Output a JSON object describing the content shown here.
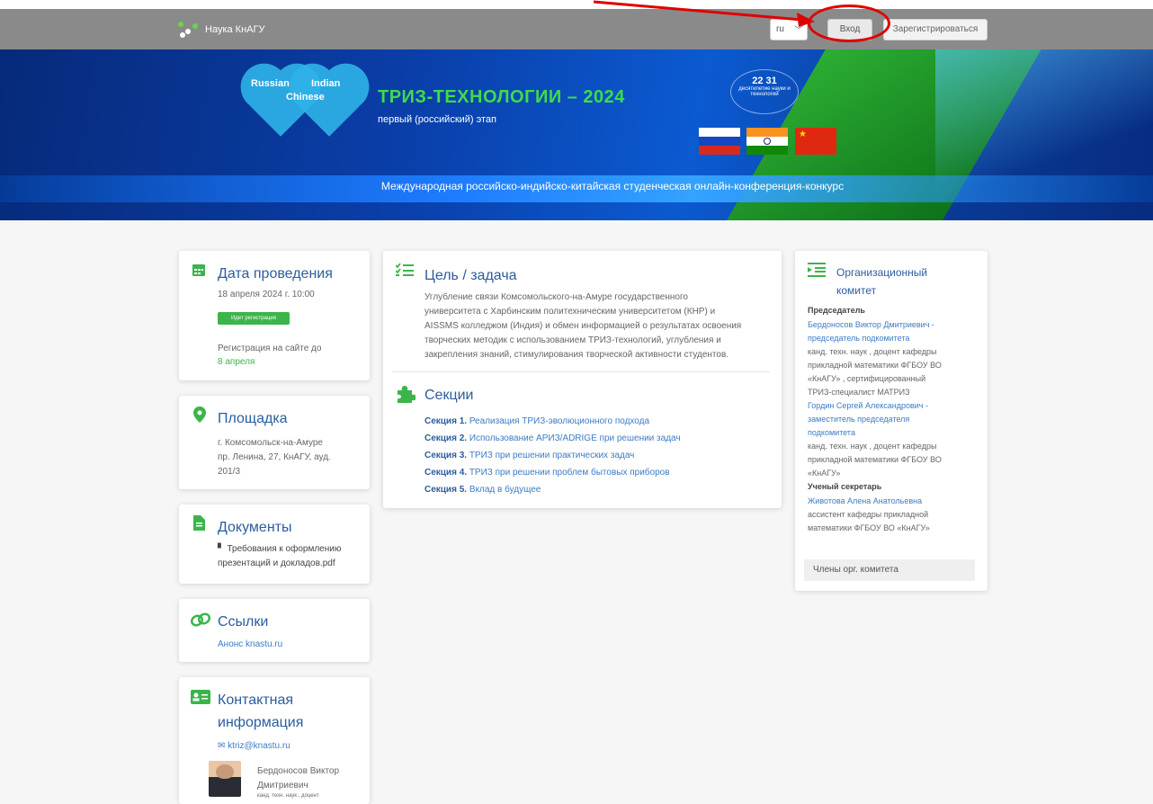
{
  "navbar": {
    "brand": "Наука КнАГУ",
    "lang": "ru",
    "login_label": "Вход",
    "register_label": "Зарегистрироваться"
  },
  "banner": {
    "heart_left": "Russian",
    "heart_right": "Indian",
    "heart_center": "Chinese",
    "title": "ТРИЗ-ТЕХНОЛОГИИ – 2024",
    "subtitle": "первый (российский) этап",
    "emblem_number": "22",
    "emblem_number2": "31",
    "emblem_text": "десятилетие науки и технологий",
    "bottom_text": "Международная российско-индийско-китайская студенческая онлайн-конференция-конкурс"
  },
  "date_card": {
    "title": "Дата проведения",
    "date": "18 апреля 2024 г. 10:00",
    "badge": "Идет регистрация",
    "reg_label": "Регистрация на сайте до",
    "reg_date": "8 апреля"
  },
  "venue_card": {
    "title": "Площадка",
    "line1": "г. Комсомольск-на-Амуре",
    "line2": "пр. Ленина, 27, КнАГУ, ауд.",
    "line3": "201/3"
  },
  "docs_card": {
    "title": "Документы",
    "doc1": "Требования к оформлению",
    "doc2": "презентаций и докладов.pdf"
  },
  "links_card": {
    "title": "Ссылки",
    "link1": "Анонс knastu.ru"
  },
  "contact_card": {
    "title1": "Контактная",
    "title2": "информация",
    "email": "ktriz@knastu.ru",
    "person1": "Бердоносов Виктор",
    "person2": "Дмитриевич",
    "person3": "канд. техн. наук , доцент"
  },
  "goal_card": {
    "title": "Цель / задача",
    "lines": [
      "Углубление связи Комсомольского-на-Амуре государственного",
      "университета с Харбинским политехническим университетом (КНР) и",
      "AISSMS колледжом (Индия) и обмен информацией о результатах освоения",
      "творческих методик с использованием ТРИЗ-технологий, углубления и",
      "закрепления знаний, стимулирования творческой активности студентов."
    ]
  },
  "sections_card": {
    "title": "Секции",
    "items": [
      {
        "num": "Секция 1.",
        "text": "Реализация ТРИЗ-эволюционного подхода"
      },
      {
        "num": "Секция 2.",
        "text": "Использование АРИЗ/ADRIGE при решении задач"
      },
      {
        "num": "Секция 3.",
        "text": "ТРИЗ при решении практических задач"
      },
      {
        "num": "Секция 4.",
        "text": "ТРИЗ при решении проблем бытовых приборов"
      },
      {
        "num": "Секция 5.",
        "text": "Вклад в будущее"
      }
    ]
  },
  "org_card": {
    "title1": "Организационный",
    "title2": "комитет",
    "chair_head": "Председатель",
    "chair_link1": "Бердоносов Виктор Дмитриевич -",
    "chair_link2": "председатель подкомитета",
    "chair_desc1": "канд. техн. наук , доцент кафедры",
    "chair_desc2": "прикладной математики ФГБОУ ВО",
    "chair_desc3": "«КнАГУ» , сертифицированный",
    "chair_desc4": "ТРИЗ-специалист МАТРИЗ",
    "dep_link1": "Гордин Сергей Александрович -",
    "dep_link2": "заместитель председателя",
    "dep_link3": "подкомитета",
    "dep_desc1": "канд. техн. наук , доцент кафедры",
    "dep_desc2": "прикладной математики ФГБОУ ВО",
    "dep_desc3": "«КнАГУ»",
    "sec_head": "Ученый секретарь",
    "sec_link": "Животова Алена Анатольевна",
    "sec_desc1": "ассистент кафедры прикладной",
    "sec_desc2": "математики ФГБОУ ВО «КнАГУ»",
    "members": "Члены орг. комитета"
  },
  "colors": {
    "accent_green": "#3bb54a",
    "link_blue": "#3c7bc6",
    "annotation_red": "#e00000"
  }
}
